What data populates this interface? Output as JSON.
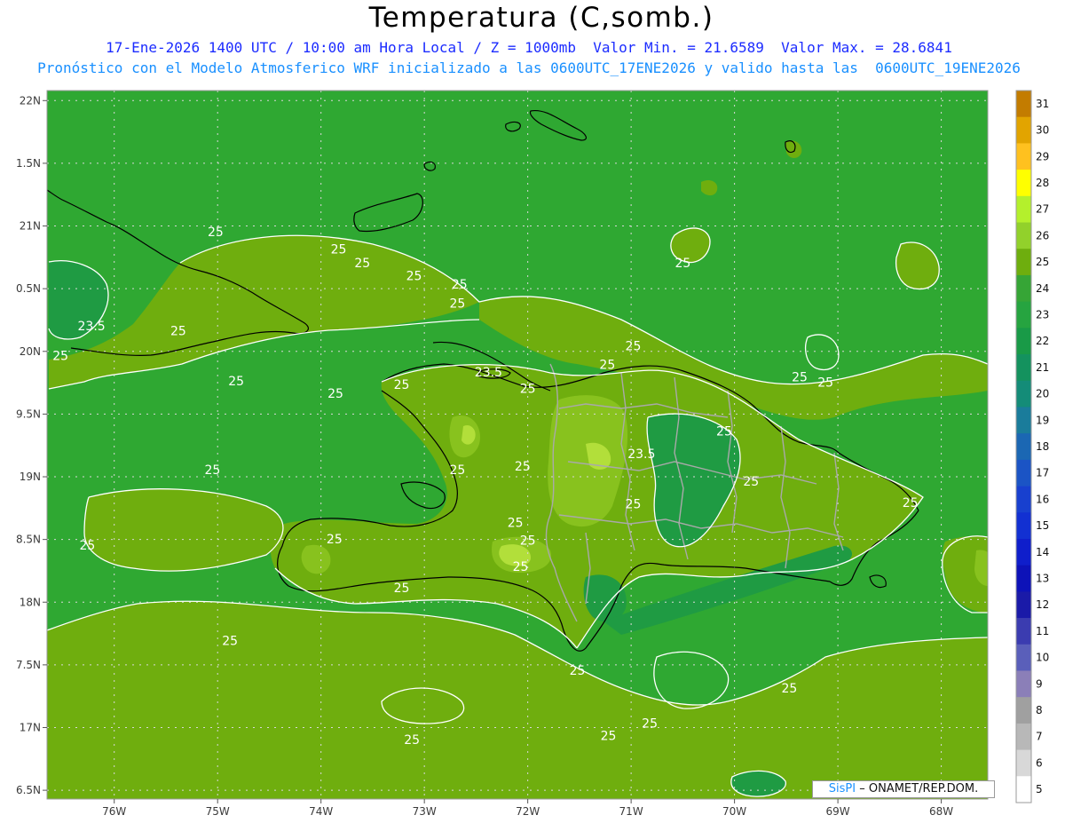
{
  "title": "Temperatura (C,somb.)",
  "subtitle_line1": "17-Ene-2026 1400 UTC / 10:00 am Hora Local / Z = 1000mb  Valor Min. = 21.6589  Valor Max. = 28.6841",
  "subtitle_line2": "Pronóstico con el Modelo Atmosferico WRF inicializado a las 0600UTC_17ENE2026 y valido hasta las  0600UTC_19ENE2026",
  "watermark": {
    "brand": "SisPI",
    "separator": "–",
    "org": "ONAMET/REP.DOM."
  },
  "colors": {
    "sea_base": "#3cb83c",
    "band_24": "#2fa832",
    "band_23": "#1f9b43",
    "band_25": "#6fae0e",
    "band_26": "#88c21e",
    "band_27": "#b2df3a",
    "band_28": "#e7f04a",
    "contour": "#ffffff",
    "coast": "#000000",
    "border": "#a9a9a9",
    "grid": "#d8d8d8"
  },
  "map": {
    "lon_range": [
      -76.65,
      -67.55
    ],
    "lat_range": [
      16.43,
      22.08
    ],
    "lon_ticks": [
      "76W",
      "75W",
      "74W",
      "73W",
      "72W",
      "71W",
      "70W",
      "69W",
      "68W"
    ],
    "lat_ticks": [
      "22N",
      "1.5N",
      "21N",
      "0.5N",
      "20N",
      "9.5N",
      "19N",
      "8.5N",
      "18N",
      "7.5N",
      "17N",
      "6.5N"
    ],
    "contour_labels": [
      {
        "text": "25",
        "lon": -75.02,
        "lat": 20.92
      },
      {
        "text": "25",
        "lon": -73.83,
        "lat": 20.78
      },
      {
        "text": "25",
        "lon": -73.6,
        "lat": 20.67
      },
      {
        "text": "25",
        "lon": -73.1,
        "lat": 20.57
      },
      {
        "text": "25",
        "lon": -72.66,
        "lat": 20.5
      },
      {
        "text": "25",
        "lon": -72.68,
        "lat": 20.35
      },
      {
        "text": "25",
        "lon": -70.5,
        "lat": 20.67
      },
      {
        "text": "23.5",
        "lon": -76.22,
        "lat": 20.17
      },
      {
        "text": "25",
        "lon": -75.38,
        "lat": 20.13
      },
      {
        "text": "25",
        "lon": -76.52,
        "lat": 19.93
      },
      {
        "text": "25",
        "lon": -74.82,
        "lat": 19.73
      },
      {
        "text": "25",
        "lon": -73.86,
        "lat": 19.63
      },
      {
        "text": "25",
        "lon": -73.22,
        "lat": 19.7
      },
      {
        "text": "23.5",
        "lon": -72.38,
        "lat": 19.8
      },
      {
        "text": "25",
        "lon": -72.0,
        "lat": 19.67
      },
      {
        "text": "25",
        "lon": -71.23,
        "lat": 19.86
      },
      {
        "text": "25",
        "lon": -70.98,
        "lat": 20.01
      },
      {
        "text": "25",
        "lon": -69.37,
        "lat": 19.76
      },
      {
        "text": "25",
        "lon": -69.12,
        "lat": 19.72
      },
      {
        "text": "25",
        "lon": -70.1,
        "lat": 19.33
      },
      {
        "text": "23.5",
        "lon": -70.9,
        "lat": 19.15
      },
      {
        "text": "25",
        "lon": -75.05,
        "lat": 19.02
      },
      {
        "text": "25",
        "lon": -72.68,
        "lat": 19.02
      },
      {
        "text": "25",
        "lon": -72.05,
        "lat": 19.05
      },
      {
        "text": "25",
        "lon": -70.98,
        "lat": 18.75
      },
      {
        "text": "25",
        "lon": -69.84,
        "lat": 18.93
      },
      {
        "text": "25",
        "lon": -68.3,
        "lat": 18.76
      },
      {
        "text": "25",
        "lon": -72.12,
        "lat": 18.6
      },
      {
        "text": "25",
        "lon": -76.26,
        "lat": 18.42
      },
      {
        "text": "25",
        "lon": -73.87,
        "lat": 18.47
      },
      {
        "text": "25",
        "lon": -72.0,
        "lat": 18.46
      },
      {
        "text": "25",
        "lon": -72.07,
        "lat": 18.25
      },
      {
        "text": "25",
        "lon": -73.22,
        "lat": 18.08
      },
      {
        "text": "25",
        "lon": -74.88,
        "lat": 17.66
      },
      {
        "text": "25",
        "lon": -71.52,
        "lat": 17.42
      },
      {
        "text": "25",
        "lon": -69.47,
        "lat": 17.28
      },
      {
        "text": "25",
        "lon": -73.12,
        "lat": 16.87
      },
      {
        "text": "25",
        "lon": -71.22,
        "lat": 16.9
      },
      {
        "text": "25",
        "lon": -70.82,
        "lat": 17.0
      }
    ]
  },
  "legend": {
    "labels": [
      "31",
      "30",
      "29",
      "28",
      "27",
      "26",
      "25",
      "24",
      "23",
      "22",
      "21",
      "20",
      "19",
      "18",
      "17",
      "16",
      "15",
      "14",
      "13",
      "12",
      "11",
      "10",
      "9",
      "8",
      "7",
      "6",
      "5"
    ],
    "colors": [
      "#c37c00",
      "#e2a400",
      "#ffc11f",
      "#ffff00",
      "#b4f02c",
      "#92d12b",
      "#6eae0e",
      "#36a536",
      "#26a440",
      "#199a47",
      "#14925e",
      "#148c78",
      "#1a7c9b",
      "#1b67b3",
      "#1b54c5",
      "#1840cf",
      "#1230d2",
      "#0f1ecb",
      "#0d12b8",
      "#1a1aa8",
      "#3b3cb0",
      "#5a5fba",
      "#8b7fb8",
      "#a0a0a0",
      "#b8b8b8",
      "#d8d8d8",
      "#ffffff"
    ]
  }
}
